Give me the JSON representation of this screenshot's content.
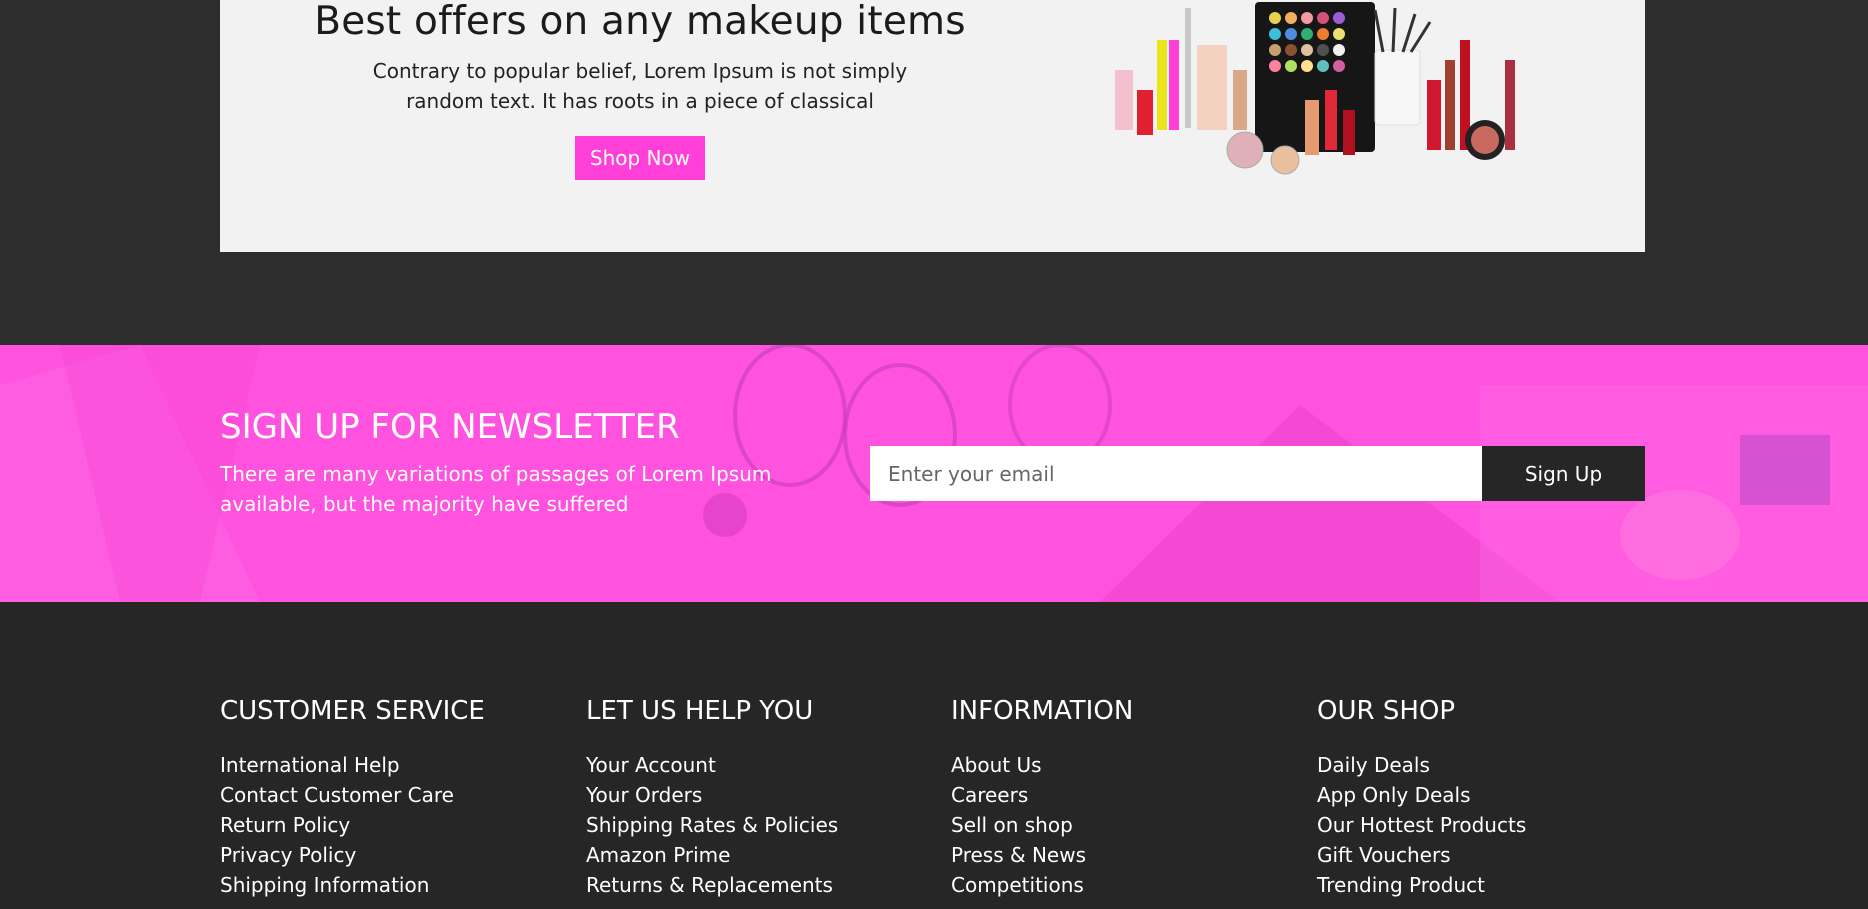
{
  "offer": {
    "title": "Best offers on any makeup items",
    "description": "Contrary to popular belief, Lorem Ipsum is not simply random text. It has roots in a piece of classical",
    "button_label": "Shop Now",
    "image": "makeup-products-photo"
  },
  "newsletter": {
    "title": "SIGN UP FOR NEWSLETTER",
    "description": "There are many variations of passages of Lorem Ipsum available, but the majority have suffered",
    "email_placeholder": "Enter your email",
    "email_value": "",
    "button_label": "Sign Up"
  },
  "footer": {
    "columns": [
      {
        "title": "CUSTOMER SERVICE",
        "links": [
          "International Help",
          "Contact Customer Care",
          "Return Policy",
          "Privacy Policy",
          "Shipping Information"
        ]
      },
      {
        "title": "LET US HELP YOU",
        "links": [
          "Your Account",
          "Your Orders",
          "Shipping Rates & Policies",
          "Amazon Prime",
          "Returns & Replacements"
        ]
      },
      {
        "title": "INFORMATION",
        "links": [
          "About Us",
          "Careers",
          "Sell on shop",
          "Press & News",
          "Competitions"
        ]
      },
      {
        "title": "OUR SHOP",
        "links": [
          "Daily Deals",
          "App Only Deals",
          "Our Hottest Products",
          "Gift Vouchers",
          "Trending Product"
        ]
      }
    ]
  },
  "colors": {
    "accent": "#ff3fd8",
    "newsletter_bg": "#ff52de",
    "dark_bg": "#2d2d2d",
    "footer_bg": "#262626",
    "card_bg": "#f2f2f2"
  }
}
